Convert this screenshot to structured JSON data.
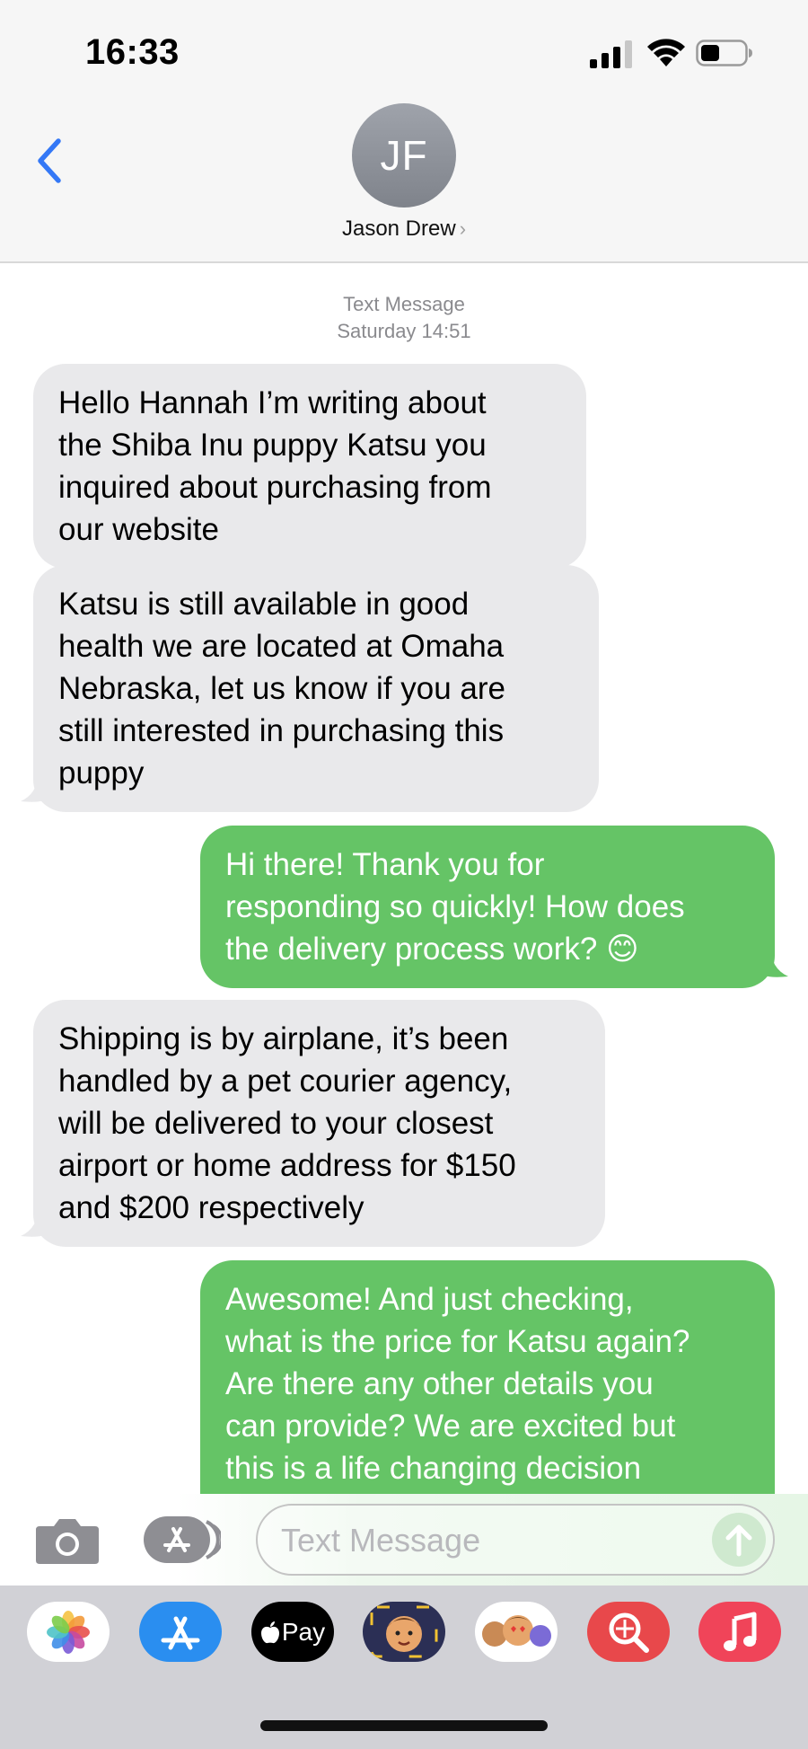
{
  "status_bar": {
    "time": "16:33"
  },
  "header": {
    "back_icon": "chevron-left-icon",
    "avatar_initials": "JF",
    "contact_name": "Jason Drew",
    "contact_chevron": "›"
  },
  "conversation": {
    "timestamp_label": "Text Message",
    "timestamp_time": "Saturday 14:51",
    "messages": [
      {
        "from": "incoming",
        "lines": [
          "Hello Hannah I’m writing about",
          "the Shiba Inu puppy Katsu you",
          "inquired about purchasing from",
          "our website"
        ]
      },
      {
        "from": "incoming",
        "lines": [
          "Katsu is still available in good",
          "health we are located at Omaha",
          "Nebraska, let us know if you are",
          "still interested in purchasing this",
          "puppy"
        ]
      },
      {
        "from": "outgoing",
        "lines": [
          "Hi there! Thank you for",
          "responding so quickly! How does",
          "the delivery process work? 😊"
        ]
      },
      {
        "from": "incoming",
        "lines": [
          "Shipping is by airplane, it’s been",
          "handled by a pet courier agency,",
          "will be delivered to your closest",
          "airport or home address for $150",
          "and $200 respectively"
        ]
      },
      {
        "from": "outgoing",
        "lines": [
          "Awesome! And just checking,",
          "what is the price for Katsu again?",
          "Are there any other details you",
          "can provide? We are excited but",
          "this is a life changing decision"
        ]
      }
    ]
  },
  "compose": {
    "placeholder": "Text Message",
    "value": "",
    "camera_icon": "camera-icon",
    "apps_icon": "app-store-icon",
    "send_icon": "send-arrow-icon"
  },
  "app_drawer": {
    "apps": [
      {
        "name": "Photos",
        "icon": "photos-icon"
      },
      {
        "name": "App Store",
        "icon": "app-store-icon"
      },
      {
        "name": "Apple Pay",
        "icon": "apple-pay-icon",
        "label": "Pay"
      },
      {
        "name": "Memoji",
        "icon": "memoji-icon"
      },
      {
        "name": "Memoji Stickers",
        "icon": "memoji-stickers-icon"
      },
      {
        "name": "Images Search",
        "icon": "image-search-icon"
      },
      {
        "name": "Music",
        "icon": "music-icon"
      }
    ]
  },
  "colors": {
    "incoming_bubble": "#e9e9eb",
    "outgoing_bubble": "#65c466",
    "accent_blue": "#3478f6",
    "header_bg": "#f6f6f6",
    "drawer_bg": "#d1d1d6"
  }
}
